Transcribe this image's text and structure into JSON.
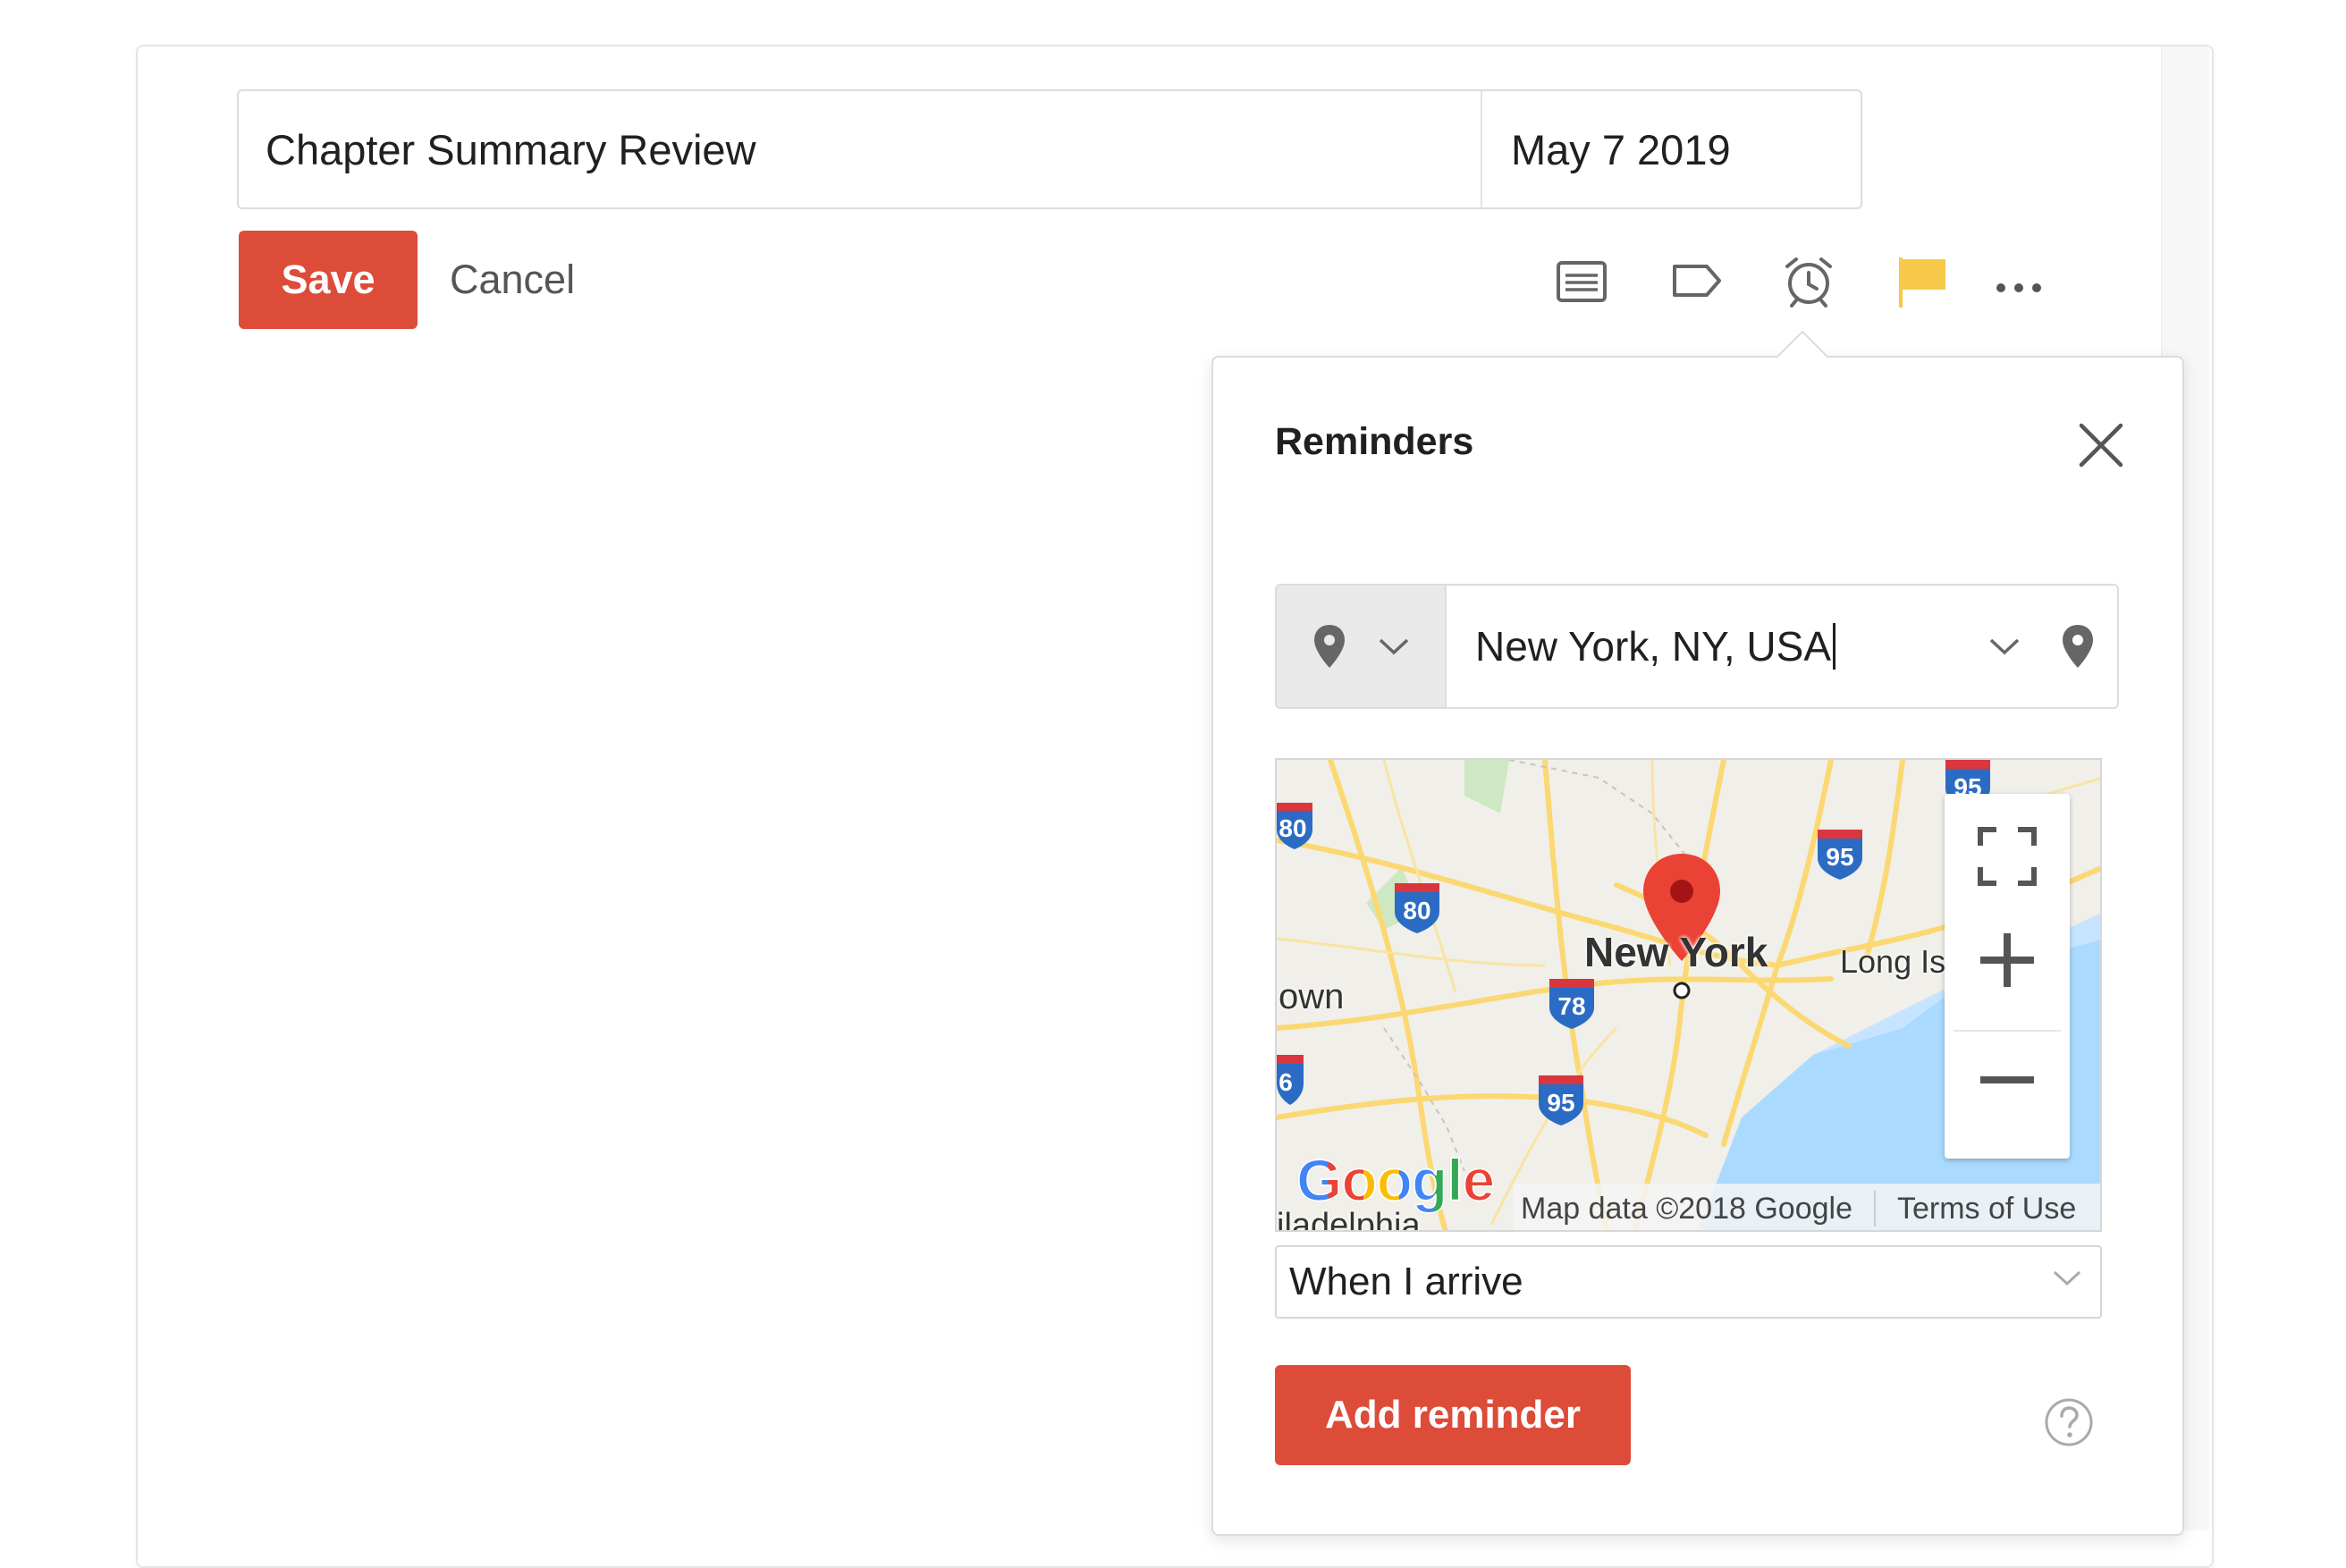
{
  "task": {
    "name": "Chapter Summary Review",
    "due_date": "May 7 2019"
  },
  "actions": {
    "save_label": "Save",
    "cancel_label": "Cancel"
  },
  "toolbar": {
    "icons": [
      "comment-icon",
      "label-icon",
      "alarm-clock-icon",
      "flag-icon",
      "more-icon"
    ],
    "flag_color": "#f7c948"
  },
  "reminders": {
    "title": "Reminders",
    "location_value": "New York, NY, USA",
    "map": {
      "city_label": "New York",
      "left_label": "own",
      "right_label": "Long Is",
      "bottom_label": "iladelphia",
      "highways": [
        "80",
        "80",
        "95",
        "78",
        "95",
        "6",
        "95"
      ],
      "footer_data": "Map data ©2018 Google",
      "footer_terms": "Terms of Use",
      "logo": "Google"
    },
    "trigger_value": "When I arrive",
    "add_label": "Add reminder"
  },
  "colors": {
    "primary": "#dd4b39",
    "map_road": "#fbd872",
    "map_water": "#aadaff",
    "pin": "#ea4335"
  }
}
